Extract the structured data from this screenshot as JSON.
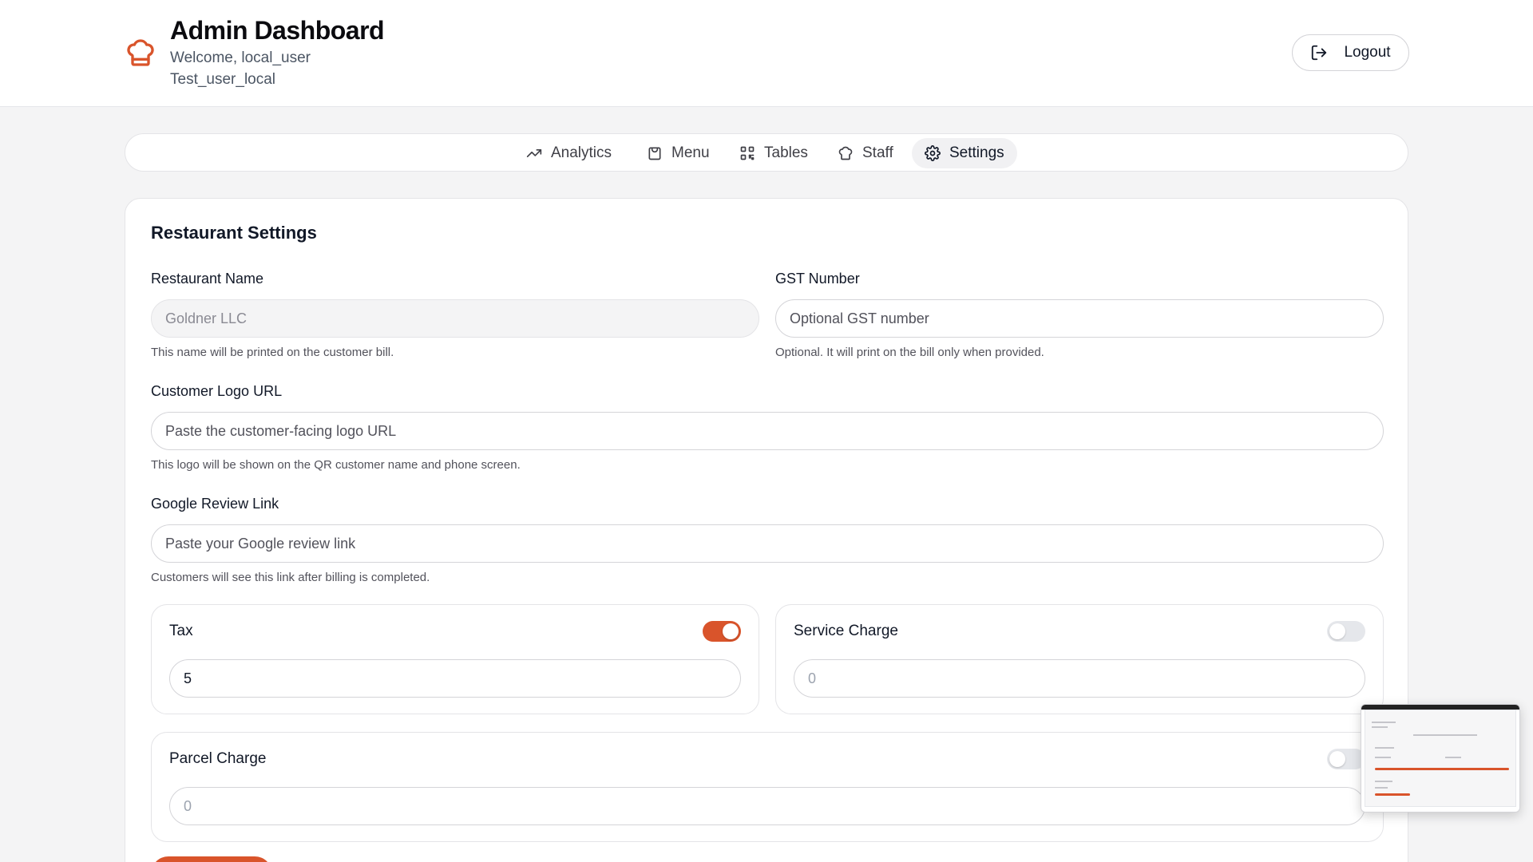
{
  "header": {
    "title": "Admin Dashboard",
    "welcome": "Welcome, local_user",
    "username": "Test_user_local",
    "logout_label": "Logout",
    "brand_icon": "chef-hat-icon"
  },
  "tabs": [
    {
      "label": "Analytics",
      "icon": "trending-up-icon"
    },
    {
      "label": "Menu",
      "icon": "shopping-bag-icon"
    },
    {
      "label": "Tables",
      "icon": "qr-code-icon"
    },
    {
      "label": "Staff",
      "icon": "chef-hat-icon"
    },
    {
      "label": "Settings",
      "icon": "gear-icon",
      "active": true
    }
  ],
  "settings": {
    "title": "Restaurant Settings",
    "restaurant_name": {
      "label": "Restaurant Name",
      "value": "Goldner LLC",
      "hint": "This name will be printed on the customer bill."
    },
    "gst": {
      "label": "GST Number",
      "placeholder": "Optional GST number",
      "hint": "Optional. It will print on the bill only when provided."
    },
    "logo_url": {
      "label": "Customer Logo URL",
      "placeholder": "Paste the customer-facing logo URL",
      "hint": "This logo will be shown on the QR customer name and phone screen."
    },
    "review_link": {
      "label": "Google Review Link",
      "placeholder": "Paste your Google review link",
      "hint": "Customers will see this link after billing is completed."
    },
    "tax": {
      "label": "Tax",
      "enabled": true,
      "value": "5"
    },
    "service_charge": {
      "label": "Service Charge",
      "enabled": false,
      "value": "0"
    },
    "parcel_charge": {
      "label": "Parcel Charge",
      "enabled": false,
      "value": "0"
    }
  },
  "colors": {
    "accent": "#d9542b",
    "background": "#f4f4f5"
  }
}
